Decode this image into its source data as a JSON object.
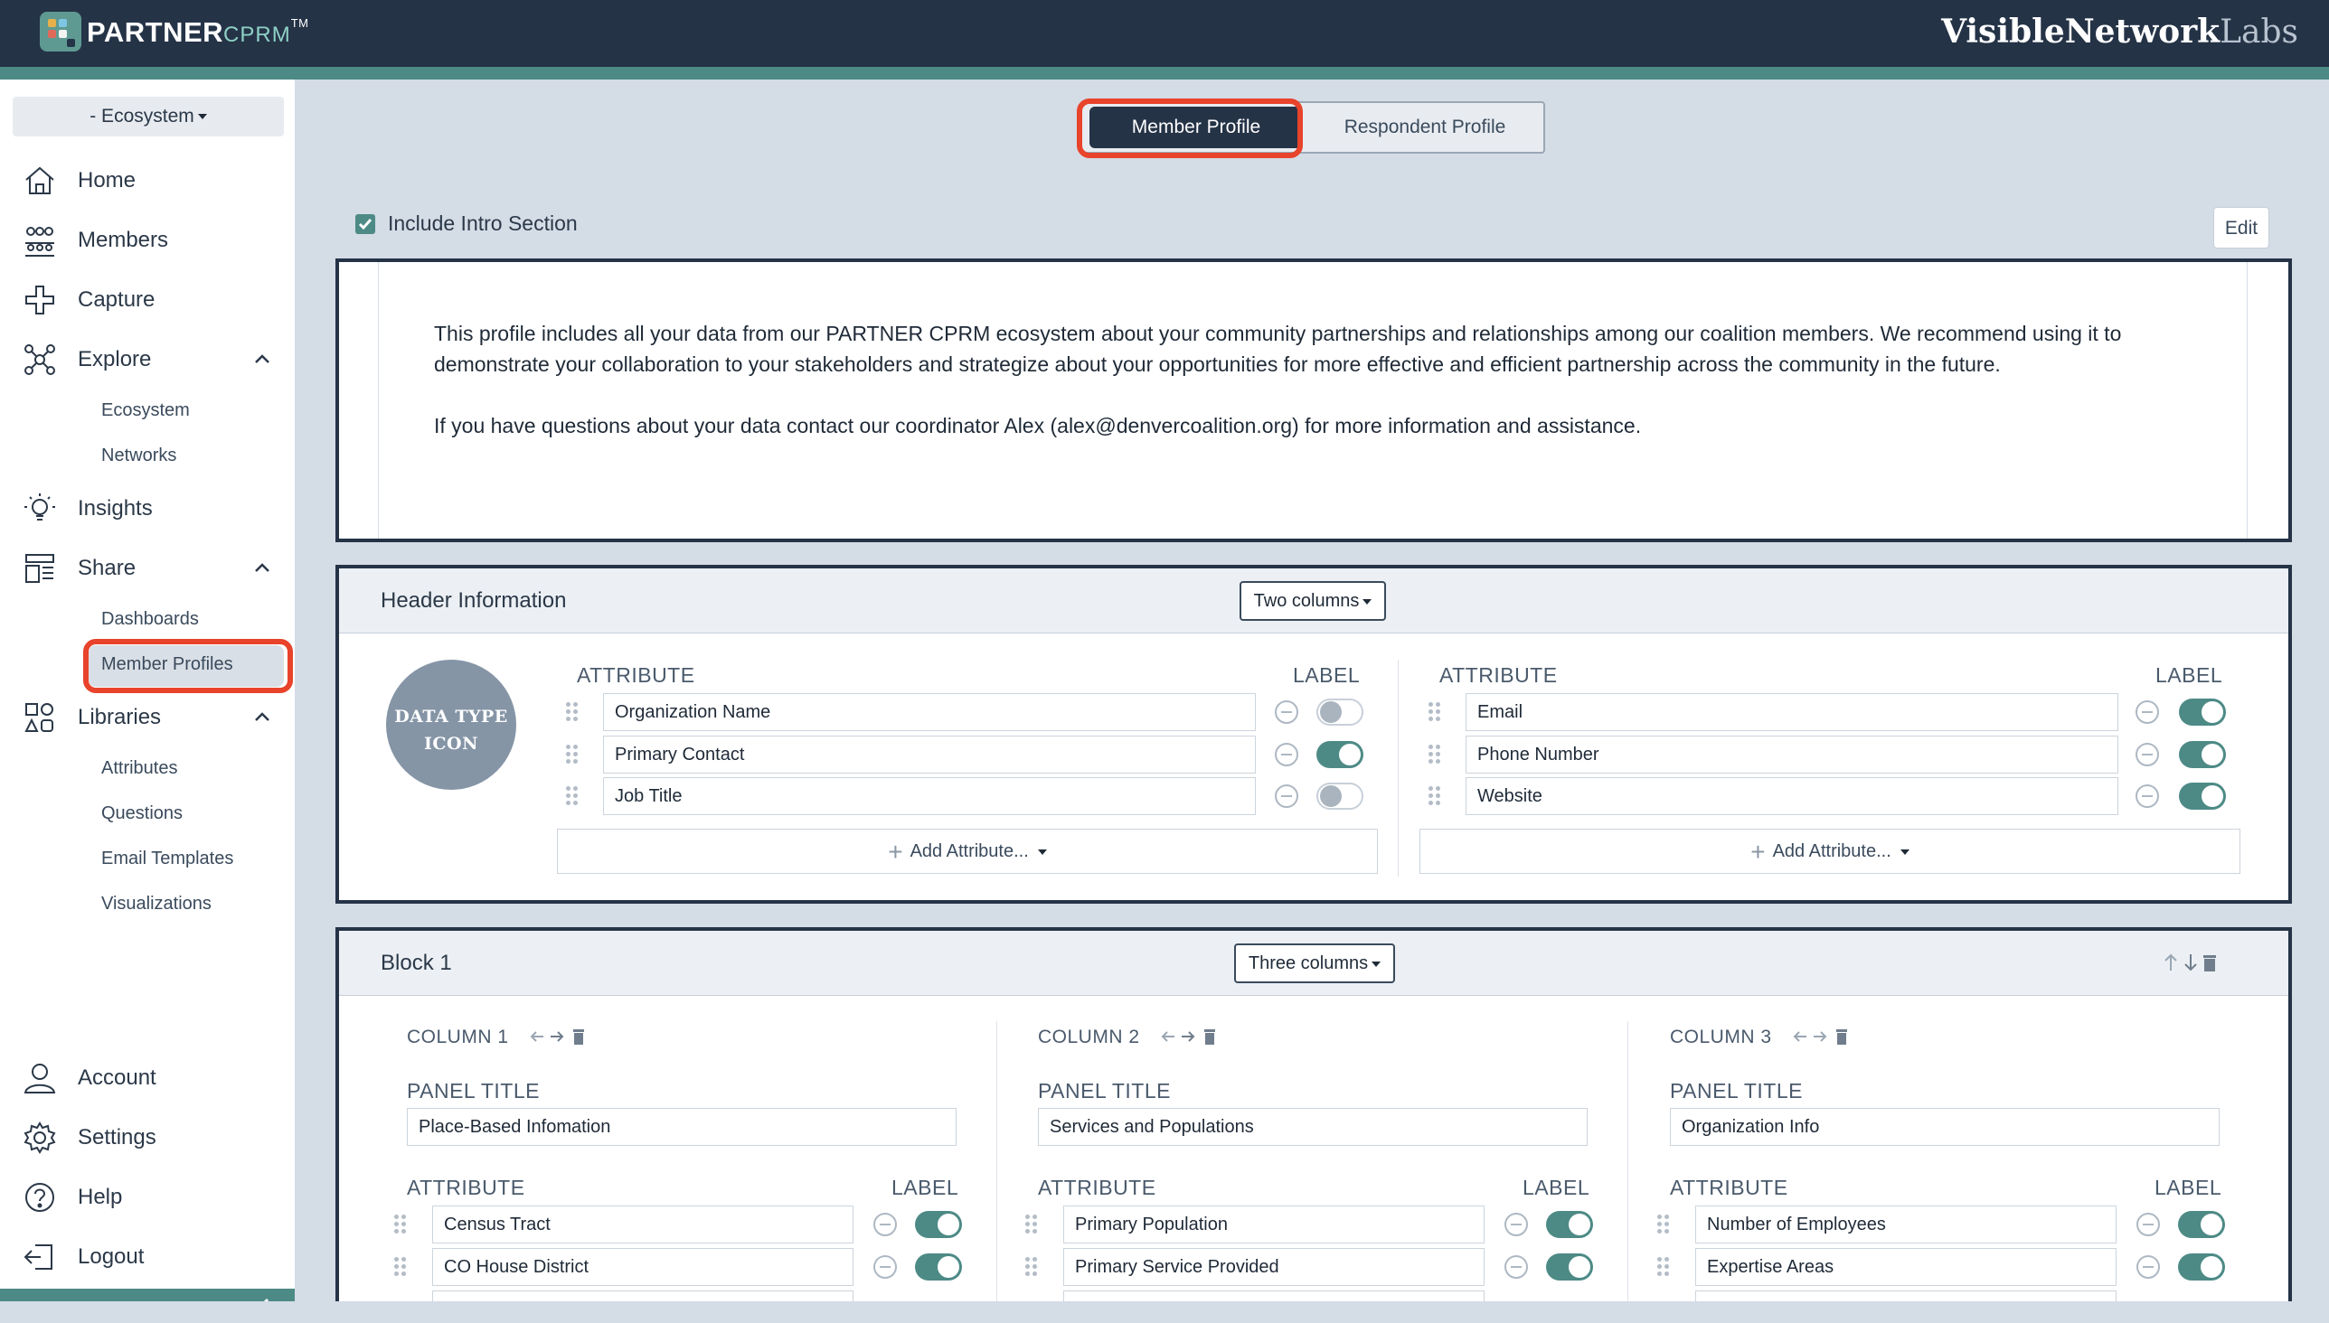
{
  "app": {
    "logo_name": "PARTNER",
    "logo_sub": "CPRM",
    "logo_tm": "TM",
    "brand_bold": "VisibleNetwork",
    "brand_light": "Labs"
  },
  "sidebar": {
    "ecosystem_select": "- Ecosystem",
    "items": {
      "home": "Home",
      "members": "Members",
      "capture": "Capture",
      "explore": "Explore",
      "explore_sub": [
        "Ecosystem",
        "Networks"
      ],
      "insights": "Insights",
      "share": "Share",
      "share_sub": [
        "Dashboards",
        "Member Profiles"
      ],
      "libraries": "Libraries",
      "libraries_sub": [
        "Attributes",
        "Questions",
        "Email Templates",
        "Visualizations"
      ],
      "account": "Account",
      "settings": "Settings",
      "help": "Help",
      "logout": "Logout"
    }
  },
  "profile_tabs": {
    "member": "Member Profile",
    "respondent": "Respondent Profile",
    "active": "member"
  },
  "intro": {
    "checkbox_label": "Include Intro Section",
    "checked": true,
    "edit_label": "Edit",
    "paragraph1_line1": "This profile includes all your data from our PARTNER CPRM ecosystem about your community partnerships and relationships among our coalition members. We recommend using it to",
    "paragraph1_line2": "demonstrate your collaboration to your stakeholders and strategize about your opportunities for more effective and efficient partnership across the community in the future.",
    "paragraph2": "If you have questions about your data contact our coordinator Alex (alex@denvercoalition.org) for more information and assistance."
  },
  "header_info": {
    "title": "Header Information",
    "layout": "Two columns",
    "icon_line1": "DATA TYPE",
    "icon_line2": "ICON",
    "attribute_header": "ATTRIBUTE",
    "label_header": "LABEL",
    "add_attribute": "Add Attribute...",
    "left": [
      {
        "name": "Organization Name",
        "label_on": false
      },
      {
        "name": "Primary Contact",
        "label_on": true
      },
      {
        "name": "Job Title",
        "label_on": false
      }
    ],
    "right": [
      {
        "name": "Email",
        "label_on": true
      },
      {
        "name": "Phone Number",
        "label_on": true
      },
      {
        "name": "Website",
        "label_on": true
      }
    ]
  },
  "block1": {
    "title": "Block 1",
    "layout": "Three columns",
    "panel_title_header": "PANEL TITLE",
    "attribute_header": "ATTRIBUTE",
    "label_header": "LABEL",
    "columns": [
      {
        "header": "COLUMN 1",
        "panel_title": "Place-Based Infomation",
        "rows": [
          "Census Tract",
          "CO House District"
        ]
      },
      {
        "header": "COLUMN 2",
        "panel_title": "Services and Populations",
        "rows": [
          "Primary Population",
          "Primary Service Provided"
        ]
      },
      {
        "header": "COLUMN 3",
        "panel_title": "Organization Info",
        "rows": [
          "Number of Employees",
          "Expertise Areas"
        ]
      }
    ]
  },
  "colors": {
    "navy": "#253347",
    "teal": "#4d8a86",
    "highlight": "#e8432b"
  }
}
